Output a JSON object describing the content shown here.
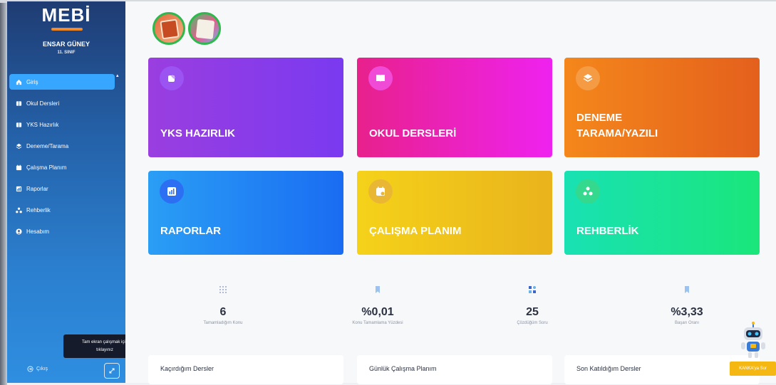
{
  "app": {
    "logo": "MEBİ",
    "user_name": "ENSAR GÜNEY",
    "user_class": "11. SINIF",
    "brand_color": "#2461a8",
    "accent_color": "#36a6ff"
  },
  "sidebar": {
    "items": [
      {
        "label": "Giriş",
        "icon": "home-icon",
        "active": true
      },
      {
        "label": "Okul Dersleri",
        "icon": "book-icon",
        "active": false
      },
      {
        "label": "YKS Hazırlık",
        "icon": "book-icon",
        "active": false
      },
      {
        "label": "Deneme/Tarama",
        "icon": "layers-icon",
        "active": false
      },
      {
        "label": "Çalışma Planım",
        "icon": "calendar-icon",
        "active": false
      },
      {
        "label": "Raporlar",
        "icon": "chart-icon",
        "active": false
      },
      {
        "label": "Rehberlik",
        "icon": "network-icon",
        "active": false
      },
      {
        "label": "Hesabım",
        "icon": "user-icon",
        "active": false
      }
    ],
    "tooltip_line1": "Tam ekran çalışmak için",
    "tooltip_line2": "tıklayınız",
    "logout_label": "Çıkış"
  },
  "cards": [
    {
      "title": "YKS HAZIRLIK",
      "icon": "pen-icon",
      "color": "#8a3ce8"
    },
    {
      "title": "OKUL DERSLERİ",
      "icon": "open-book-icon",
      "color": "#ec22c0"
    },
    {
      "title": "DENEME\nTARAMA/YAZILI",
      "icon": "layers-icon",
      "color": "#ec741c"
    },
    {
      "title": "RAPORLAR",
      "icon": "chart-icon",
      "color": "#2185f3"
    },
    {
      "title": "ÇALIŞMA PLANIM",
      "icon": "calendar-icon",
      "color": "#efc21b"
    },
    {
      "title": "REHBERLİK",
      "icon": "network-icon",
      "color": "#1ae39a"
    }
  ],
  "stats": [
    {
      "value": "6",
      "label": "Tamamladığım Konu",
      "icon": "grid-dots-icon"
    },
    {
      "value": "%0,01",
      "label": "Konu Tamamlama Yüzdesi",
      "icon": "bookmark-icon"
    },
    {
      "value": "25",
      "label": "Çözdüğüm Soru",
      "icon": "shapes-icon"
    },
    {
      "value": "%3,33",
      "label": "Başarı Oranı",
      "icon": "bookmark-icon"
    }
  ],
  "panels": [
    {
      "title": "Kaçırdığım Dersler"
    },
    {
      "title": "Günlük Çalışma Planım"
    },
    {
      "title": "Son Katıldığım Dersler"
    }
  ],
  "assistant": {
    "button_label": "KANKA'ya Sor"
  }
}
